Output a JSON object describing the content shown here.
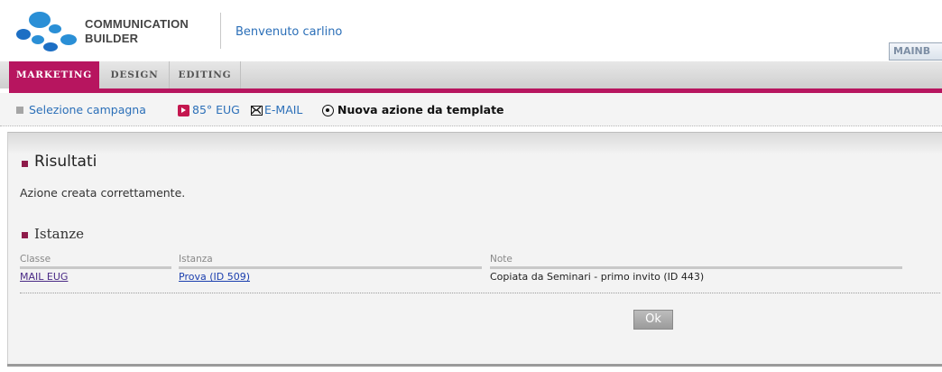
{
  "brand": {
    "line1": "COMMUNICATION",
    "line2": "BUILDER",
    "welcome": "Benvenuto carlino",
    "badge": "MAINB"
  },
  "tabs": [
    {
      "label": "MARKETING",
      "active": true
    },
    {
      "label": "DESIGN",
      "active": false
    },
    {
      "label": "EDITING",
      "active": false
    }
  ],
  "breadcrumb": {
    "selection": "Selezione campagna",
    "campaign": "85° EUG",
    "channel": "E-MAIL",
    "current": "Nuova azione da template"
  },
  "results": {
    "title": "Risultati",
    "message": "Azione creata correttamente."
  },
  "instances": {
    "title": "Istanze",
    "columns": [
      "Classe",
      "Istanza",
      "Note"
    ],
    "rows": [
      {
        "classe": "MAIL EUG",
        "istanza": "Prova (ID 509)",
        "note": "Copiata da Seminari - primo invito (ID 443)"
      }
    ]
  },
  "ok_label": "Ok",
  "colors": {
    "accent": "#b7155f",
    "link": "#2b6fb8",
    "section_marker": "#8e1b4a"
  }
}
